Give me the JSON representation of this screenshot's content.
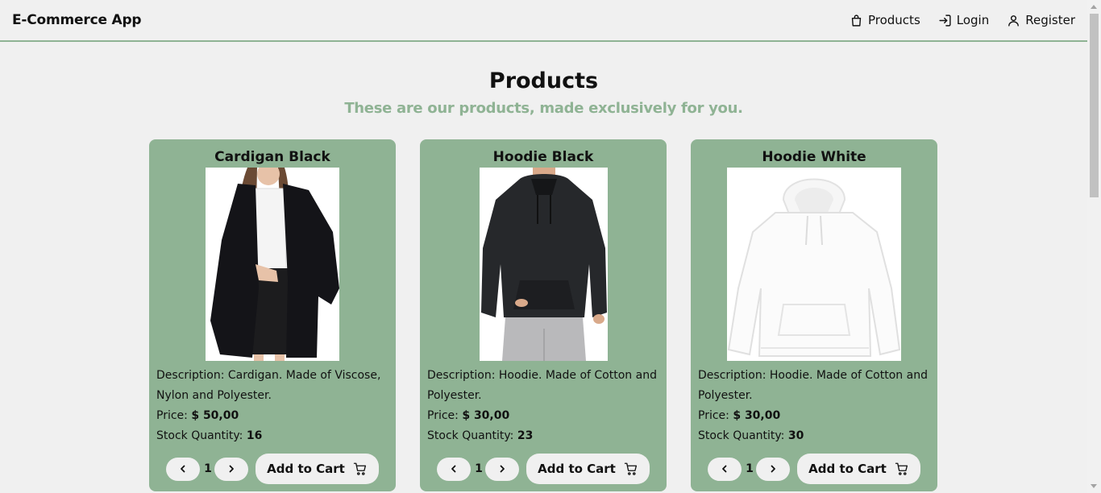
{
  "navbar": {
    "brand": "E-Commerce App",
    "links": [
      {
        "label": "Products",
        "icon": "bag-icon"
      },
      {
        "label": "Login",
        "icon": "login-icon"
      },
      {
        "label": "Register",
        "icon": "user-icon"
      }
    ]
  },
  "page": {
    "title": "Products",
    "subtitle": "These are our products, made exclusively for you."
  },
  "colors": {
    "accent": "#8fb394",
    "background": "#f0f0f0"
  },
  "products": [
    {
      "name": "Cardigan Black",
      "description": "Description: Cardigan. Made of Viscose, Nylon and Polyester.",
      "price_label": "Price:",
      "price": "$ 50,00",
      "stock_label": "Stock Quantity:",
      "stock": "16",
      "quantity": "1",
      "cart_label": "Add to Cart"
    },
    {
      "name": "Hoodie Black",
      "description": "Description: Hoodie. Made of Cotton and Polyester.",
      "price_label": "Price:",
      "price": "$ 30,00",
      "stock_label": "Stock Quantity:",
      "stock": "23",
      "quantity": "1",
      "cart_label": "Add to Cart"
    },
    {
      "name": "Hoodie White",
      "description": "Description: Hoodie. Made of Cotton and Polyester.",
      "price_label": "Price:",
      "price": "$ 30,00",
      "stock_label": "Stock Quantity:",
      "stock": "30",
      "quantity": "1",
      "cart_label": "Add to Cart"
    }
  ]
}
